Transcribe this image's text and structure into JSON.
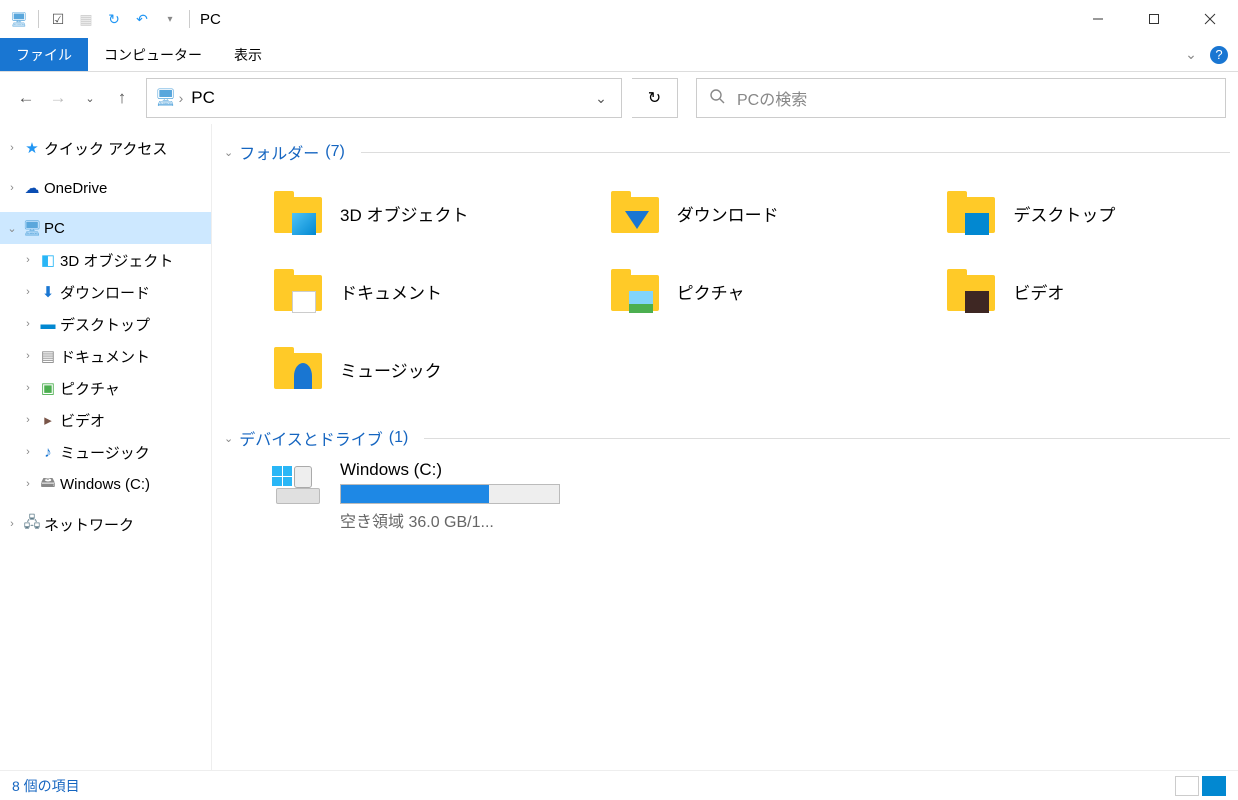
{
  "title": "PC",
  "ribbon": {
    "file": "ファイル",
    "computer": "コンピューター",
    "view": "表示"
  },
  "nav": {
    "address_crumb": "PC",
    "search_placeholder": "PCの検索"
  },
  "sidebar": {
    "quick_access": "クイック アクセス",
    "onedrive": "OneDrive",
    "pc": "PC",
    "children": {
      "objects3d": "3D オブジェクト",
      "downloads": "ダウンロード",
      "desktop": "デスクトップ",
      "documents": "ドキュメント",
      "pictures": "ピクチャ",
      "videos": "ビデオ",
      "music": "ミュージック",
      "cdrive": "Windows (C:)"
    },
    "network": "ネットワーク"
  },
  "groups": {
    "folders": {
      "label": "フォルダー",
      "count": "(7)"
    },
    "drives": {
      "label": "デバイスとドライブ",
      "count": "(1)"
    }
  },
  "folders": {
    "objects3d": "3D オブジェクト",
    "downloads": "ダウンロード",
    "desktop": "デスクトップ",
    "documents": "ドキュメント",
    "pictures": "ピクチャ",
    "videos": "ビデオ",
    "music": "ミュージック"
  },
  "drive": {
    "name": "Windows (C:)",
    "free": "空き領域 36.0 GB/1...",
    "used_pct": 68
  },
  "status": {
    "count": "8 個の項目"
  }
}
